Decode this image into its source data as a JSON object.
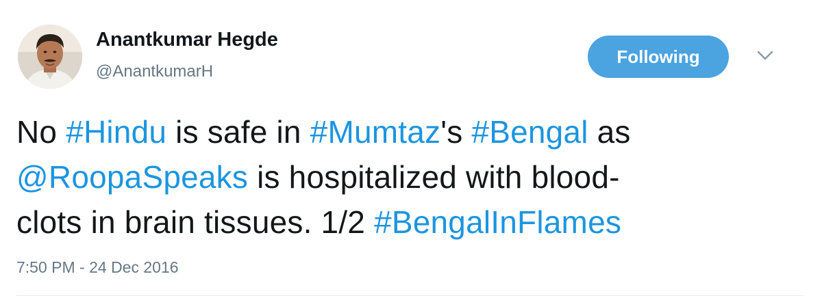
{
  "user": {
    "display_name": "Anantkumar Hegde",
    "handle": "@AnantkumarH"
  },
  "follow_button": {
    "label": "Following",
    "color": "#4ba3e0"
  },
  "menu": {
    "icon": "chevron-down-icon"
  },
  "tweet": {
    "line1": {
      "t1": "No ",
      "hashtag_hindu": "#Hindu",
      "t2": " is safe in ",
      "hashtag_mumtaz": "#Mumtaz",
      "t3": "'s ",
      "hashtag_bengal": "#Bengal",
      "t4": " as"
    },
    "line2": {
      "mention": "@RoopaSpeaks",
      "t1": " is hospitalized with blood-"
    },
    "line3": {
      "t1": "clots in brain tissues. 1/2 ",
      "hashtag_bengalinflames": "#BengalInFlames"
    },
    "link_color": "#1b95e0"
  },
  "timestamp": "7:50 PM - 24 Dec 2016"
}
